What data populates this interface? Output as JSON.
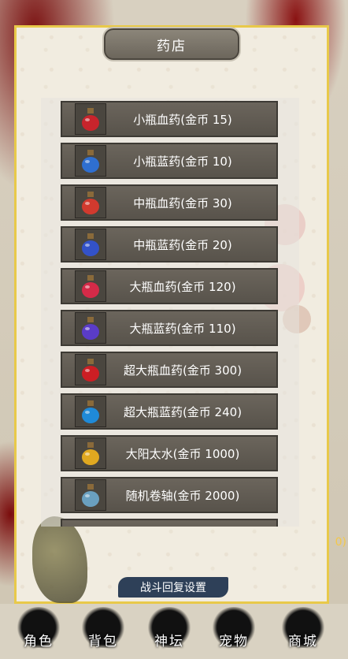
{
  "shop": {
    "title": "药店",
    "items": [
      {
        "label": "小瓶血药(金币 15)",
        "icon": "small-red-potion-icon",
        "color": "#c8242c"
      },
      {
        "label": "小瓶蓝药(金币 10)",
        "icon": "small-blue-potion-icon",
        "color": "#2f6fd0"
      },
      {
        "label": "中瓶血药(金币 30)",
        "icon": "medium-red-potion-icon",
        "color": "#d23a2e"
      },
      {
        "label": "中瓶蓝药(金币 20)",
        "icon": "medium-blue-potion-icon",
        "color": "#3352c8"
      },
      {
        "label": "大瓶血药(金币 120)",
        "icon": "large-red-potion-icon",
        "color": "#d42a48"
      },
      {
        "label": "大瓶蓝药(金币 110)",
        "icon": "large-blue-potion-icon",
        "color": "#5a3cc8"
      },
      {
        "label": "超大瓶血药(金币 300)",
        "icon": "extra-large-red-potion-icon",
        "color": "#cc1e24"
      },
      {
        "label": "超大瓶蓝药(金币 240)",
        "icon": "extra-large-blue-potion-icon",
        "color": "#1f8ad8"
      },
      {
        "label": "大阳太水(金币 1000)",
        "icon": "sun-water-bottles-icon",
        "color": "#e0a820"
      },
      {
        "label": "随机卷轴(金币 2000)",
        "icon": "random-scroll-icon",
        "color": "#6aa0c0"
      }
    ],
    "settings_label": "战斗回复设置"
  },
  "side_number": "0)",
  "nav": [
    {
      "label": "角色",
      "icon": "character-icon"
    },
    {
      "label": "背包",
      "icon": "backpack-icon"
    },
    {
      "label": "神坛",
      "icon": "altar-icon"
    },
    {
      "label": "宠物",
      "icon": "pet-icon"
    },
    {
      "label": "商城",
      "icon": "mall-icon"
    }
  ]
}
